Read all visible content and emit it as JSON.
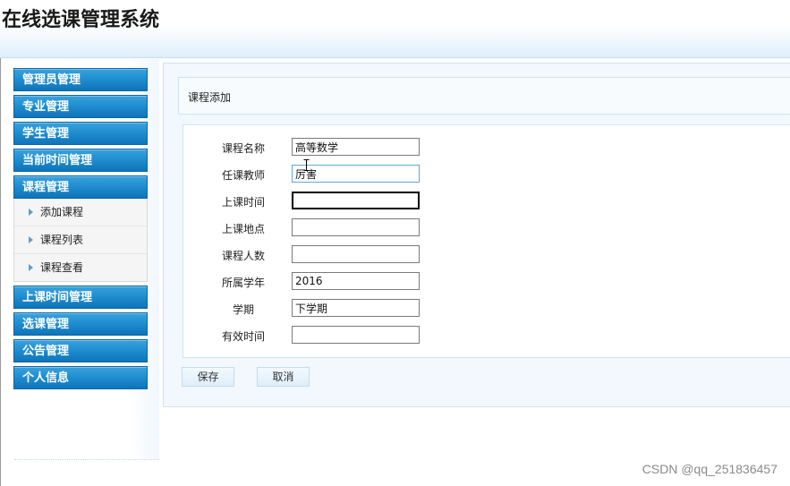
{
  "header": {
    "title": "在线选课管理系统"
  },
  "sidebar": {
    "menus": [
      {
        "label": "管理员管理"
      },
      {
        "label": "专业管理"
      },
      {
        "label": "学生管理"
      },
      {
        "label": "当前时间管理"
      },
      {
        "label": "课程管理",
        "expanded": true,
        "items": [
          {
            "label": "添加课程"
          },
          {
            "label": "课程列表"
          },
          {
            "label": "课程查看"
          }
        ]
      },
      {
        "label": "上课时间管理"
      },
      {
        "label": "选课管理"
      },
      {
        "label": "公告管理"
      },
      {
        "label": "个人信息"
      }
    ]
  },
  "main": {
    "section_title": "课程添加",
    "form": {
      "course_name": {
        "label": "课程名称",
        "value": "高等数学"
      },
      "teacher": {
        "label": "任课教师",
        "value": "厉害"
      },
      "class_time": {
        "label": "上课时间",
        "value": ""
      },
      "location": {
        "label": "上课地点",
        "value": ""
      },
      "capacity": {
        "label": "课程人数",
        "value": ""
      },
      "school_year": {
        "label": "所属学年",
        "value": "2016"
      },
      "semester": {
        "label": "学期",
        "value": "下学期"
      },
      "valid_time": {
        "label": "有效时间",
        "value": ""
      }
    },
    "buttons": {
      "save": "保存",
      "cancel": "取消"
    }
  },
  "watermark": "CSDN @qq_251836457",
  "colors": {
    "menu_blue": "#1e8ccf",
    "panel_bg": "#f2f8fd",
    "panel_border": "#cfe3f2"
  }
}
